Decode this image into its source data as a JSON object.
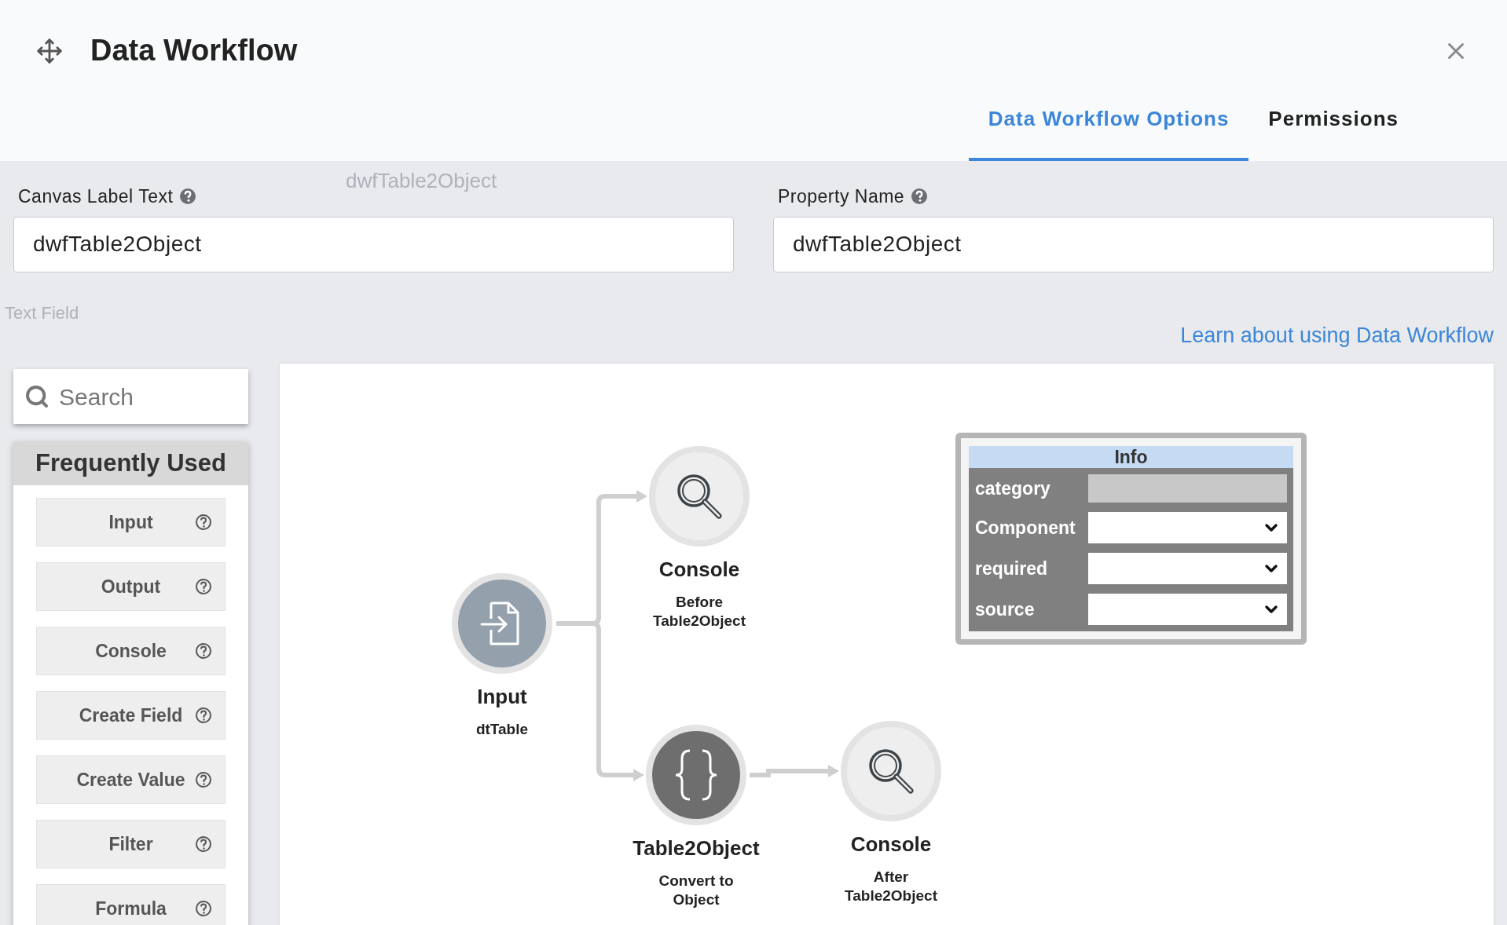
{
  "window": {
    "title": "Data Workflow"
  },
  "tabs": [
    {
      "label": "Data Workflow Options",
      "selected": true
    },
    {
      "label": "Permissions",
      "selected": false
    }
  ],
  "background_texts": [
    "dwfTable2Object",
    "Text Field"
  ],
  "fields": [
    {
      "label": "Canvas Label Text",
      "value": "dwfTable2Object"
    },
    {
      "label": "Property Name",
      "value": "dwfTable2Object"
    }
  ],
  "help_link": "Learn about using Data Workflow",
  "search": {
    "placeholder": "Search"
  },
  "palette": {
    "title": "Frequently Used",
    "items": [
      "Input",
      "Output",
      "Console",
      "Create Field",
      "Create Value",
      "Filter",
      "Formula"
    ]
  },
  "nodes": [
    {
      "kind": "input",
      "title": "Input",
      "subtitle": "dtTable"
    },
    {
      "kind": "console",
      "title": "Console",
      "subtitle": "Before Table2Object"
    },
    {
      "kind": "transform",
      "title": "Table2Object",
      "subtitle": "Convert to Object"
    },
    {
      "kind": "console",
      "title": "Console",
      "subtitle": "After Table2Object"
    }
  ],
  "info": {
    "title": "Info",
    "rows": [
      {
        "label": "category",
        "kind": "text",
        "disabled": true
      },
      {
        "label": "Component",
        "kind": "select",
        "disabled": false
      },
      {
        "label": "required",
        "kind": "select",
        "disabled": false
      },
      {
        "label": "source",
        "kind": "select",
        "disabled": false
      }
    ]
  }
}
